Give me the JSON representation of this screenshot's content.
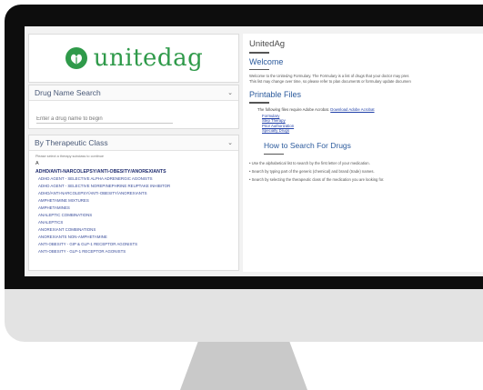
{
  "brand": {
    "name": "unitedag",
    "accent": "#2f9a4a"
  },
  "left": {
    "search": {
      "title": "Drug Name Search",
      "placeholder": "Enter a drug name to begin"
    },
    "therapeutic": {
      "title": "By Therapeutic Class",
      "hint": "Please select a therapy subclass to continue",
      "letter": "A",
      "items": [
        "ADHD/ANTI-NARCOLEPSY/ANTI-OBESITY/ANOREXIANTS",
        "ADHD AGENT - SELECTIVE ALPHA ADRENERGIC AGONISTS",
        "ADHD AGENT - SELECTIVE NOREPINEPHRINE REUPTAKE INHIBITOR",
        "ADHD/ANTI-NARCOLEPSY/ANTI-OBESITY/ANOREXIANTS",
        "AMPHETAMINE MIXTURES",
        "AMPHETAMINES",
        "ANALEPTIC COMBINATIONS",
        "ANALEPTICS",
        "ANOREXIANT COMBINATIONS",
        "ANOREXIANTS NON-AMPHETAMINE",
        "ANTI-OBESITY - GIP & GLP-1 RECEPTOR AGONISTS",
        "ANTI-OBESITY - GLP-1 RECEPTOR AGONISTS"
      ]
    }
  },
  "right": {
    "site_title": "UnitedAg",
    "welcome_heading": "Welcome",
    "welcome_line1": "Welcome to the UnitedAg Formulary. The Formulary is a list of drugs that your doctor may pres",
    "welcome_line2": "This list may change over time, so please refer to plan documents or formulary update documen",
    "files_heading": "Printable Files",
    "files_note": "The following files require Adobe Acrobat.",
    "files_link": "Download Adobe Acrobat",
    "files": [
      "Formulary",
      "Step Therapy",
      "Prior Authorization",
      "Specialty Drugs"
    ],
    "howto_heading": "How to Search For Drugs",
    "howto": [
      "Use the alphabetical list to search by the first letter of your medication.",
      "Search by typing part of the generic (chemical) and brand (trade) names.",
      "Search by selecting the therapeutic class of the medication you are looking for."
    ]
  }
}
